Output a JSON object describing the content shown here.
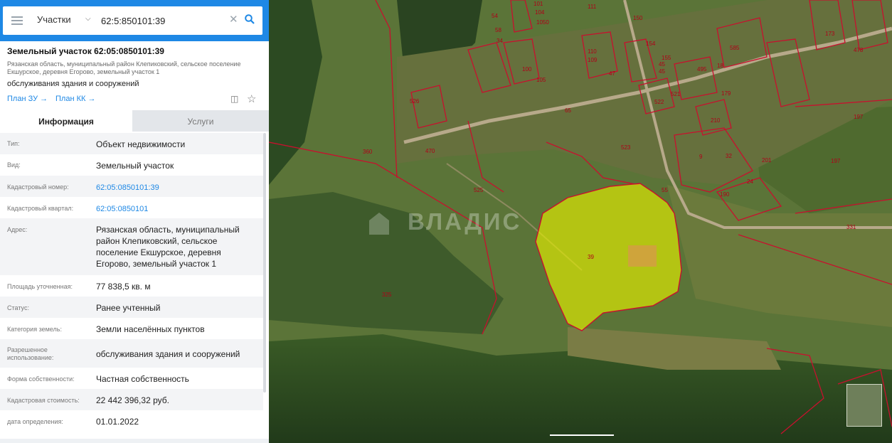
{
  "search": {
    "layer_label": "Участки",
    "query": "62:5:850101:39"
  },
  "object": {
    "title": "Земельный участок 62:05:0850101:39",
    "address": "Рязанская область, муниципальный район Клепиковский, сельское поселение Екшурское, деревня Егорово, земельный участок 1",
    "use": "обслуживания здания и сооружений",
    "link_plan_zu": "План ЗУ →",
    "link_plan_kk": "План КК →"
  },
  "tabs": [
    {
      "label": "Информация",
      "active": true
    },
    {
      "label": "Услуги",
      "active": false
    }
  ],
  "info_rows": [
    {
      "label": "Тип:",
      "value": "Объект недвижимости"
    },
    {
      "label": "Вид:",
      "value": "Земельный участок"
    },
    {
      "label": "Кадастровый номер:",
      "value": "62:05:0850101:39",
      "link": true
    },
    {
      "label": "Кадастровый квартал:",
      "value": "62:05:0850101",
      "link": true
    },
    {
      "label": "Адрес:",
      "value": "Рязанская область, муниципальный район Клепиковский, сельское поселение Екшурское, деревня Егорово, земельный участок 1"
    },
    {
      "label": "Площадь уточненная:",
      "value": "77 838,5 кв. м"
    },
    {
      "label": "Статус:",
      "value": "Ранее учтенный"
    },
    {
      "label": "Категория земель:",
      "value": "Земли населённых пунктов"
    },
    {
      "label": "Разрешенное использование:",
      "value": "обслуживания здания и сооружений"
    },
    {
      "label": "Форма собственности:",
      "value": "Частная собственность"
    },
    {
      "label": "Кадастровая стоимость:",
      "value": "22 442 396,32 руб."
    },
    {
      "label": "дата определения:",
      "value": "01.01.2022"
    }
  ],
  "map": {
    "watermark": "ВЛАДИС",
    "selected_lot_label": "39",
    "highlight_color": "#e5f000",
    "boundary_color": "#c8102e",
    "lot_labels": [
      "54",
      "58",
      "526",
      "101",
      "104",
      "1050",
      "111",
      "150",
      "34",
      "110",
      "154",
      "109",
      "155",
      "47",
      "45",
      "495",
      "45",
      "18",
      "521",
      "522",
      "210",
      "197",
      "65",
      "523",
      "360",
      "470",
      "525",
      "197",
      "331",
      "32",
      "9",
      "55",
      "190",
      "24",
      "201",
      "325",
      "585",
      "179",
      "173",
      "478",
      "100",
      "105"
    ]
  },
  "icons": {
    "menu": "hamburger-icon",
    "dropdown": "chevron-down-icon",
    "clear": "close-icon",
    "search": "search-icon",
    "collapse": "chevron-left-icon",
    "plan": "document-search-icon",
    "favorite": "star-icon"
  }
}
